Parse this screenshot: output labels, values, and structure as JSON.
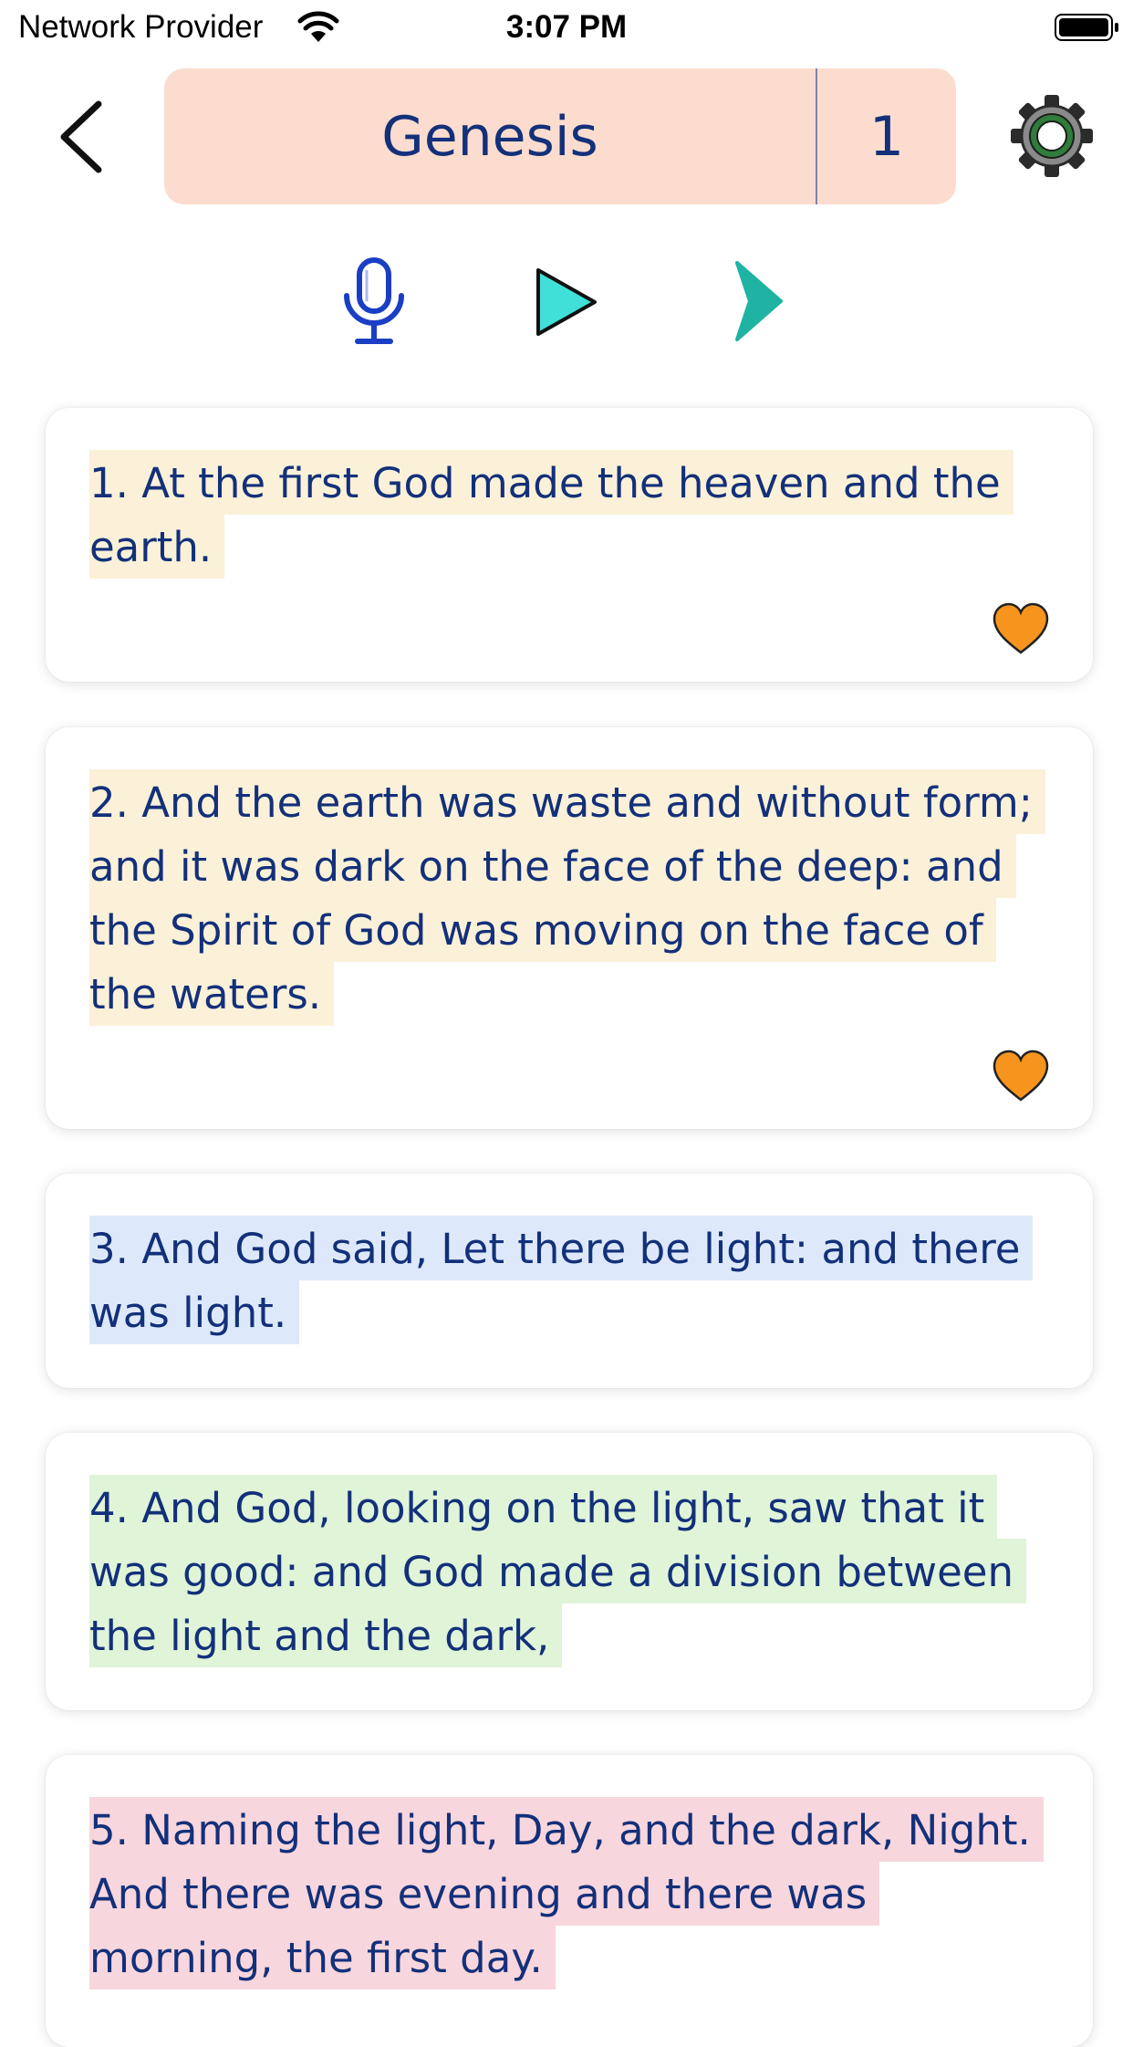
{
  "status_bar": {
    "carrier": "Network Provider",
    "time": "3:07 PM"
  },
  "header": {
    "book": "Genesis",
    "chapter": "1"
  },
  "controls": {
    "icons": [
      "back-icon",
      "gear-icon",
      "microphone-icon",
      "play-icon",
      "next-chevron-icon"
    ],
    "colors": {
      "selector_bg": "#fbdcce",
      "text": "#13307a",
      "mic": "#1a3fc4",
      "play": "#40e0d8",
      "next": "#1fb3a3",
      "favorite": "#f7941d"
    }
  },
  "verses": [
    {
      "text": "1. At the first God made the heaven and the earth.",
      "highlight": "#fbf1d8",
      "favorite": true
    },
    {
      "text": "2. And the earth was waste and without form; and it was dark on the face of the deep: and the Spirit of God was moving on the face of the waters.",
      "highlight": "#fbf1d8",
      "favorite": true
    },
    {
      "text": "3. And God said, Let there be light: and there was light.",
      "highlight": "#dde9fb",
      "favorite": false
    },
    {
      "text": "4. And God, looking on the light, saw that it was good: and God made a division between the light and the dark,",
      "highlight": "#e0f4d8",
      "favorite": false
    },
    {
      "text": "5. Naming the light, Day, and the dark, Night. And there was evening and there was morning, the first day.",
      "highlight": "#f8d6dd",
      "favorite": false
    }
  ]
}
